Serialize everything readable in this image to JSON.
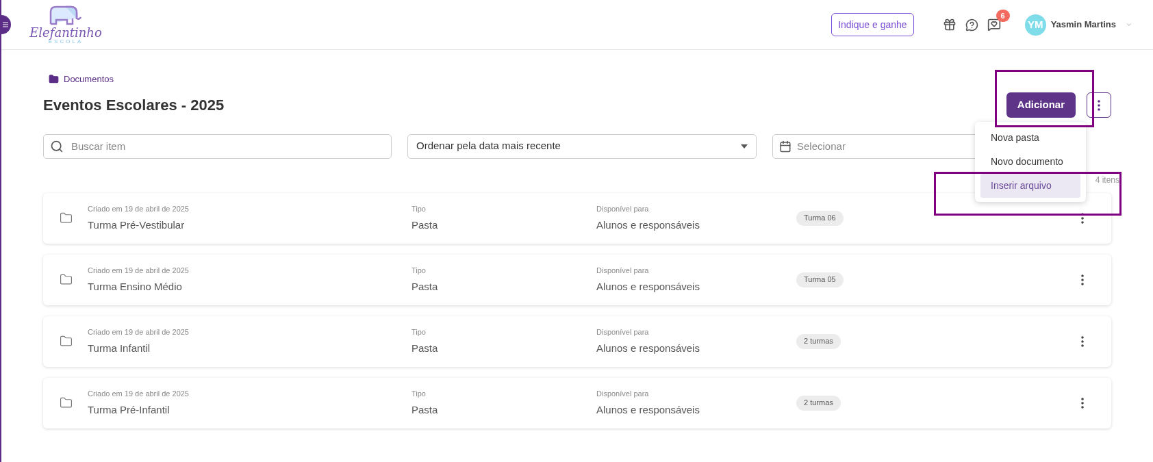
{
  "header": {
    "logo": {
      "name": "Elefantinho",
      "tagline": "ESCOLA"
    },
    "refer_button": "Indique e ganhe",
    "notifications_badge": "6",
    "user": {
      "initials": "YM",
      "name": "Yasmin Martins"
    }
  },
  "breadcrumb": "Documentos",
  "title": "Eventos Escolares - 2025",
  "add_button": "Adicionar",
  "add_menu": [
    {
      "label": "Nova pasta",
      "highlighted": false
    },
    {
      "label": "Novo documento",
      "highlighted": false
    },
    {
      "label": "Inserir arquivo",
      "highlighted": true
    }
  ],
  "filters": {
    "search_placeholder": "Buscar item",
    "sort_value": "Ordenar pela data mais recente",
    "date_placeholder": "Selecionar"
  },
  "item_count": "4 itens",
  "items": [
    {
      "created": "Criado em 19 de abril de 2025",
      "name": "Turma Pré-Vestibular",
      "type_label": "Tipo",
      "type": "Pasta",
      "available_label": "Disponível para",
      "available": "Alunos e responsáveis",
      "tag": "Turma 06"
    },
    {
      "created": "Criado em 19 de abril de 2025",
      "name": "Turma Ensino Médio",
      "type_label": "Tipo",
      "type": "Pasta",
      "available_label": "Disponível para",
      "available": "Alunos e responsáveis",
      "tag": "Turma 05"
    },
    {
      "created": "Criado em 19 de abril de 2025",
      "name": "Turma Infantil",
      "type_label": "Tipo",
      "type": "Pasta",
      "available_label": "Disponível para",
      "available": "Alunos e responsáveis",
      "tag": "2 turmas"
    },
    {
      "created": "Criado em 19 de abril de 2025",
      "name": "Turma Pré-Infantil",
      "type_label": "Tipo",
      "type": "Pasta",
      "available_label": "Disponível para",
      "available": "Alunos e responsáveis",
      "tag": "2 turmas"
    }
  ]
}
